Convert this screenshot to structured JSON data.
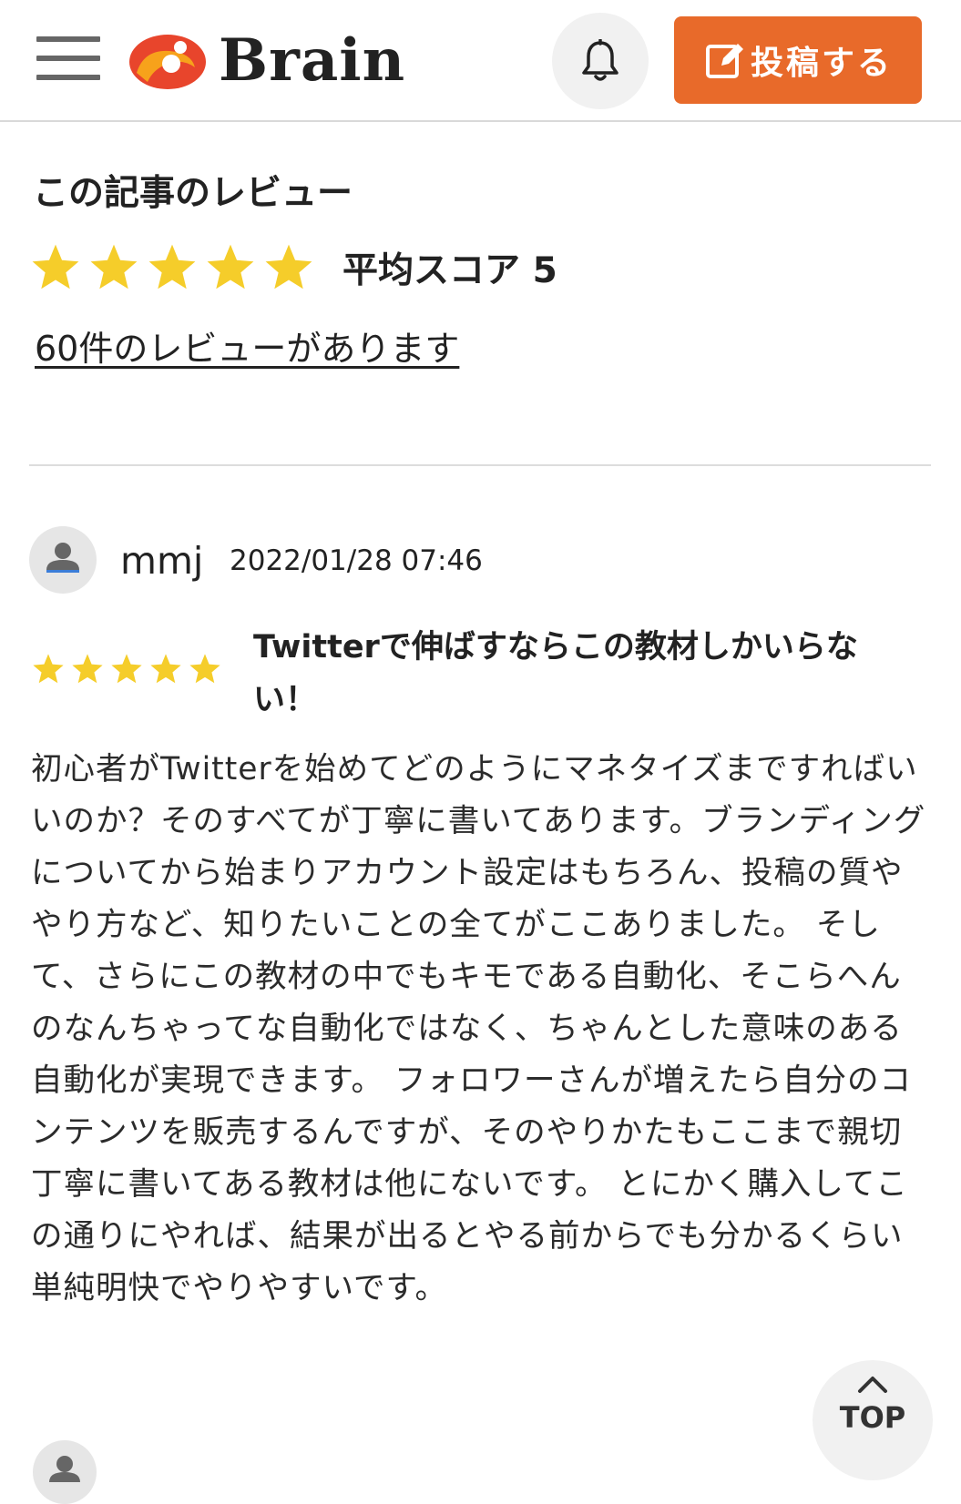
{
  "header": {
    "logo_text": "Brain",
    "post_button_label": "投稿する",
    "icons": {
      "menu": "hamburger-menu-icon",
      "logo": "brain-logo-icon",
      "bell": "bell-icon",
      "post": "edit-icon"
    }
  },
  "colors": {
    "accent": "#e86a2a",
    "star": "#f5cd2a",
    "text": "#222222",
    "divider": "#dddddd"
  },
  "summary": {
    "title": "この記事のレビュー",
    "rating_stars": 5,
    "average_label": "平均スコア 5",
    "review_count_link": "60件のレビューがあります"
  },
  "review": {
    "username": "mmj",
    "date": "2022/01/28 07:46",
    "rating_stars": 5,
    "title": "Twitterで伸ばすならこの教材しかいらない！",
    "body": "初心者がTwitterを始めてどのようにマネタイズまですればいいのか？そのすべてが丁寧に書いてあります。ブランディングについてから始まりアカウント設定はもちろん、投稿の質ややり方など、知りたいことの全てがここありました。 そして、さらにこの教材の中でもキモである自動化、そこらへんのなんちゃってな自動化ではなく、ちゃんとした意味のある自動化が実現できます。 フォロワーさんが増えたら自分のコンテンツを販売するんですが、そのやりかたもここまで親切丁寧に書いてある教材は他にないです。 とにかく購入してこの通りにやれば、結果が出るとやる前からでも分かるくらい単純明快でやりやすいです。"
  },
  "top_button_label": "TOP"
}
